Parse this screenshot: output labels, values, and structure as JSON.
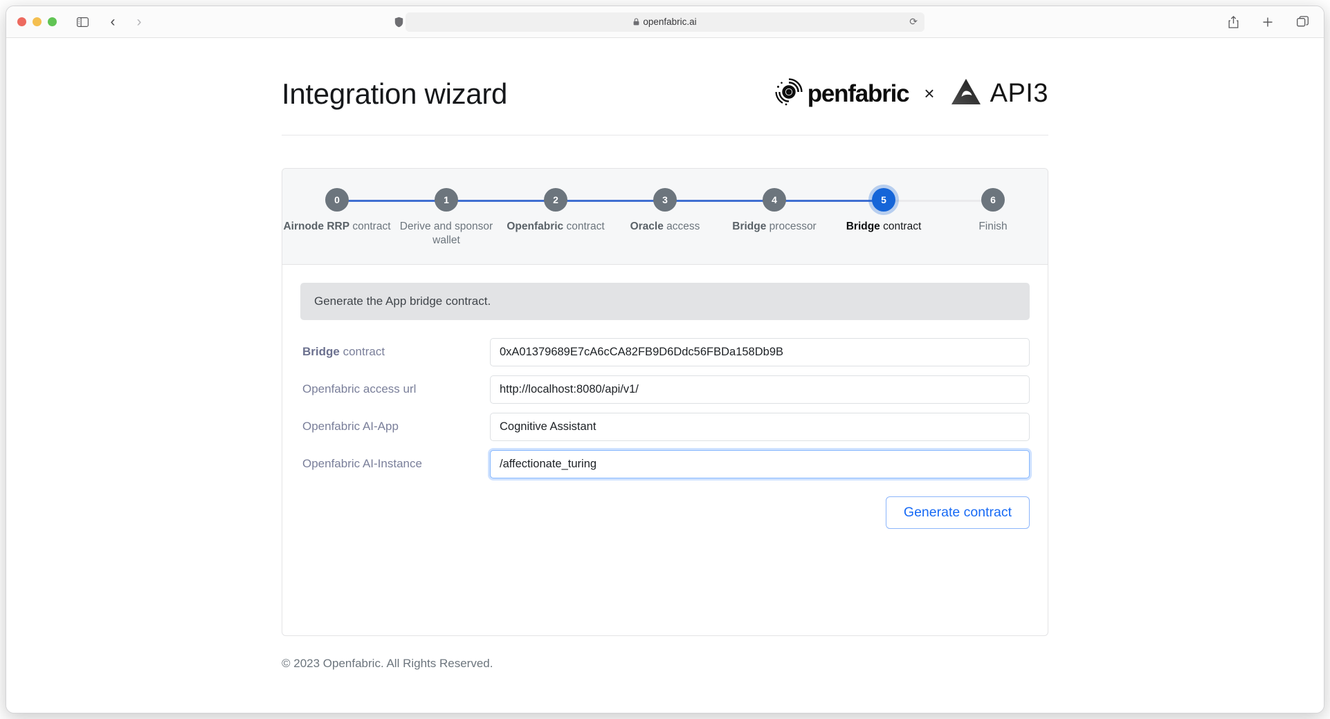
{
  "browser": {
    "traffic_lights": [
      "close",
      "minimize",
      "zoom"
    ],
    "sidebar_icon": "sidebar-icon",
    "back_icon": "chevron-left-icon",
    "forward_icon": "chevron-right-icon",
    "shield_icon": "shield-icon",
    "lock_icon": "lock-icon",
    "url": "openfabric.ai",
    "reload_icon": "reload-icon",
    "share_icon": "share-icon",
    "new_tab_icon": "plus-icon",
    "tabs_icon": "tabs-overview-icon",
    "colors": {
      "red": "#ed6a5f",
      "yellow": "#f4bf50",
      "green": "#61c454"
    }
  },
  "header": {
    "title": "Integration wizard",
    "openfabric_logo_icon": "openfabric-logo-icon",
    "openfabric_word": "penfabric",
    "separator": "×",
    "api3_logo_icon": "api3-triangle-logo-icon",
    "api3_word": "API3"
  },
  "stepper": {
    "active_index": 5,
    "steps": [
      {
        "number": "0",
        "bold": "Airnode RRP",
        "rest": " contract",
        "state": "done"
      },
      {
        "number": "1",
        "bold": "",
        "rest": "Derive and sponsor wallet",
        "state": "done"
      },
      {
        "number": "2",
        "bold": "Openfabric",
        "rest": " contract",
        "state": "done"
      },
      {
        "number": "3",
        "bold": "Oracle",
        "rest": " access",
        "state": "done"
      },
      {
        "number": "4",
        "bold": "Bridge",
        "rest": " processor",
        "state": "done"
      },
      {
        "number": "5",
        "bold": "Bridge",
        "rest": " contract",
        "state": "active"
      },
      {
        "number": "6",
        "bold": "",
        "rest": "Finish",
        "state": "upcoming"
      }
    ]
  },
  "main": {
    "alert": "Generate the App bridge contract.",
    "fields": [
      {
        "label_bold": "Bridge",
        "label_rest": " contract",
        "value": "0xA01379689E7cA6cCA82FB9D6Ddc56FBDa158Db9B",
        "placeholder": "",
        "focused": false,
        "name": "bridge-contract"
      },
      {
        "label_bold": "",
        "label_rest": "Openfabric access url",
        "value": "http://localhost:8080/api/v1/",
        "placeholder": "",
        "focused": false,
        "name": "openfabric-access-url"
      },
      {
        "label_bold": "",
        "label_rest": "Openfabric AI-App",
        "value": "Cognitive Assistant",
        "placeholder": "",
        "focused": false,
        "name": "openfabric-ai-app"
      },
      {
        "label_bold": "",
        "label_rest": "Openfabric AI-Instance",
        "value": "/affectionate_turing",
        "placeholder": "",
        "focused": true,
        "name": "openfabric-ai-instance"
      }
    ],
    "generate_button": "Generate contract"
  },
  "footer": {
    "copyright": "© 2023 Openfabric. All Rights Reserved."
  },
  "colors": {
    "primary": "#1565d8",
    "step_done": "#6c757d",
    "link": "#176af5",
    "alert_bg": "#e2e3e5",
    "stepper_bg": "#f6f7f8"
  }
}
